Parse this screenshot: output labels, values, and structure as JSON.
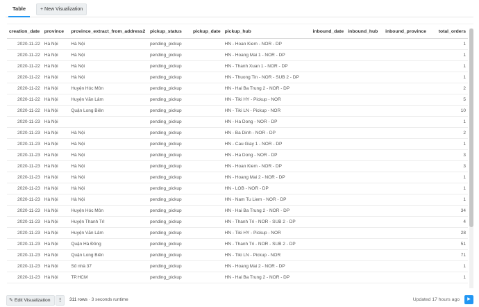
{
  "tabs": {
    "active": "Table",
    "new_visualization": "+ New Visualization"
  },
  "columns": [
    "creation_date",
    "province",
    "province_extract_from_address2",
    "pickup_status",
    "pickup_date",
    "pickup_hub",
    "inbound_date",
    "inbound_hub",
    "inbound_province",
    "total_orders"
  ],
  "rows": [
    [
      "2020-11-22",
      "Hà Nội",
      "Hà Nội",
      "pending_pickup",
      "",
      "HN - Hoan Kiem - NOR - DP",
      "",
      "",
      "",
      "1"
    ],
    [
      "2020-11-22",
      "Hà Nội",
      "Hà Nội",
      "pending_pickup",
      "",
      "HN - Hoang Mai 1 - NOR - DP",
      "",
      "",
      "",
      "1"
    ],
    [
      "2020-11-22",
      "Hà Nội",
      "Hà Nội",
      "pending_pickup",
      "",
      "HN - Thanh Xuan 1 - NOR - DP",
      "",
      "",
      "",
      "1"
    ],
    [
      "2020-11-22",
      "Hà Nội",
      "Hà Nội",
      "pending_pickup",
      "",
      "HN - Thuong Tin - NOR - SUB 2 - DP",
      "",
      "",
      "",
      "1"
    ],
    [
      "2020-11-22",
      "Hà Nội",
      "Huyện Hóc Môn",
      "pending_pickup",
      "",
      "HN - Hai Ba Trung 2 - NOR - DP",
      "",
      "",
      "",
      "2"
    ],
    [
      "2020-11-22",
      "Hà Nội",
      "Huyện Văn Lâm",
      "pending_pickup",
      "",
      "HN - Tiki HY - Pickup - NOR",
      "",
      "",
      "",
      "5"
    ],
    [
      "2020-11-22",
      "Hà Nội",
      "Quận Long Biên",
      "pending_pickup",
      "",
      "HN - Tiki LN - Pickup - NOR",
      "",
      "",
      "",
      "10"
    ],
    [
      "2020-11-23",
      "Hà Nội",
      "",
      "pending_pickup",
      "",
      "HN - Ha Dong - NOR - DP",
      "",
      "",
      "",
      "1"
    ],
    [
      "2020-11-23",
      "Hà Nội",
      "Hà Nội",
      "pending_pickup",
      "",
      "HN - Ba Dinh - NOR - DP",
      "",
      "",
      "",
      "2"
    ],
    [
      "2020-11-23",
      "Hà Nội",
      "Hà Nội",
      "pending_pickup",
      "",
      "HN - Cau Giay 1 - NOR - DP",
      "",
      "",
      "",
      "1"
    ],
    [
      "2020-11-23",
      "Hà Nội",
      "Hà Nội",
      "pending_pickup",
      "",
      "HN - Ha Dong - NOR - DP",
      "",
      "",
      "",
      "3"
    ],
    [
      "2020-11-23",
      "Hà Nội",
      "Hà Nội",
      "pending_pickup",
      "",
      "HN - Hoan Kiem - NOR - DP",
      "",
      "",
      "",
      "3"
    ],
    [
      "2020-11-23",
      "Hà Nội",
      "Hà Nội",
      "pending_pickup",
      "",
      "HN - Hoang Mai 2 - NOR - DP",
      "",
      "",
      "",
      "1"
    ],
    [
      "2020-11-23",
      "Hà Nội",
      "Hà Nội",
      "pending_pickup",
      "",
      "HN - LOB - NOR - DP",
      "",
      "",
      "",
      "1"
    ],
    [
      "2020-11-23",
      "Hà Nội",
      "Hà Nội",
      "pending_pickup",
      "",
      "HN - Nam Tu Liem - NOR - DP",
      "",
      "",
      "",
      "1"
    ],
    [
      "2020-11-23",
      "Hà Nội",
      "Huyện Hóc Môn",
      "pending_pickup",
      "",
      "HN - Hai Ba Trung 2 - NOR - DP",
      "",
      "",
      "",
      "34"
    ],
    [
      "2020-11-23",
      "Hà Nội",
      "Huyện Thanh Trì",
      "pending_pickup",
      "",
      "HN - Thanh Tri - NOR - SUB 2 - DP",
      "",
      "",
      "",
      "4"
    ],
    [
      "2020-11-23",
      "Hà Nội",
      "Huyện Văn Lâm",
      "pending_pickup",
      "",
      "HN - Tiki HY - Pickup - NOR",
      "",
      "",
      "",
      "28"
    ],
    [
      "2020-11-23",
      "Hà Nội",
      "Quận Hà Đông",
      "pending_pickup",
      "",
      "HN - Thanh Tri - NOR - SUB 2 - DP",
      "",
      "",
      "",
      "51"
    ],
    [
      "2020-11-23",
      "Hà Nội",
      "Quận Long Biên",
      "pending_pickup",
      "",
      "HN - Tiki LN - Pickup - NOR",
      "",
      "",
      "",
      "71"
    ],
    [
      "2020-11-23",
      "Hà Nội",
      "Số nhà 37",
      "pending_pickup",
      "",
      "HN - Hoang Mai 2 - NOR - DP",
      "",
      "",
      "",
      "1"
    ],
    [
      "2020-11-23",
      "Hà Nội",
      "TP.HCM",
      "pending_pickup",
      "",
      "HN - Hai Ba Trung 2 - NOR - DP",
      "",
      "",
      "",
      "1"
    ]
  ],
  "footer": {
    "edit_label": "Edit Visualization",
    "kebab": "⋮",
    "rows_count": "311 rows",
    "runtime": "· 3 seconds runtime",
    "updated": "Updated 17 hours ago"
  },
  "icons": {
    "edit": "pencil-icon",
    "refresh": "play-icon"
  },
  "colors": {
    "accent": "#2196f3",
    "button_bg": "#eceff1"
  }
}
